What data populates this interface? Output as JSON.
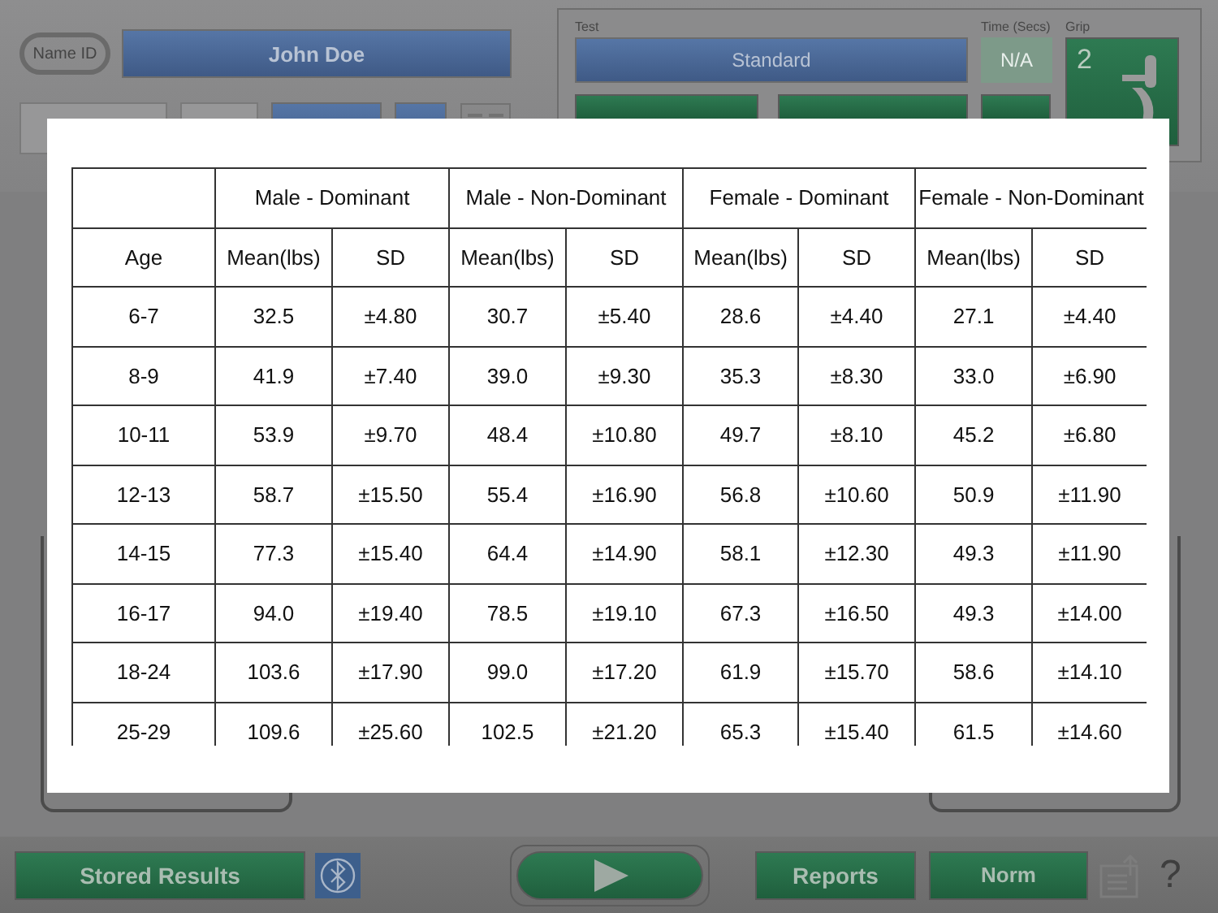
{
  "header": {
    "name_id_label": "Name ID",
    "name": "John Doe"
  },
  "test_panel": {
    "test_label": "Test",
    "test": "Standard",
    "time_label": "Time (Secs)",
    "time": "N/A",
    "grip_label": "Grip",
    "grip": "2"
  },
  "norms_table": {
    "groups": [
      "Male - Dominant",
      "Male - Non-Dominant",
      "Female - Dominant",
      "Female - Non-Dominant"
    ],
    "columns": [
      "Age",
      "Mean(lbs)",
      "SD",
      "Mean(lbs)",
      "SD",
      "Mean(lbs)",
      "SD",
      "Mean(lbs)",
      "SD"
    ],
    "rows": [
      [
        "6-7",
        "32.5",
        "±4.80",
        "30.7",
        "±5.40",
        "28.6",
        "±4.40",
        "27.1",
        "±4.40"
      ],
      [
        "8-9",
        "41.9",
        "±7.40",
        "39.0",
        "±9.30",
        "35.3",
        "±8.30",
        "33.0",
        "±6.90"
      ],
      [
        "10-11",
        "53.9",
        "±9.70",
        "48.4",
        "±10.80",
        "49.7",
        "±8.10",
        "45.2",
        "±6.80"
      ],
      [
        "12-13",
        "58.7",
        "±15.50",
        "55.4",
        "±16.90",
        "56.8",
        "±10.60",
        "50.9",
        "±11.90"
      ],
      [
        "14-15",
        "77.3",
        "±15.40",
        "64.4",
        "±14.90",
        "58.1",
        "±12.30",
        "49.3",
        "±11.90"
      ],
      [
        "16-17",
        "94.0",
        "±19.40",
        "78.5",
        "±19.10",
        "67.3",
        "±16.50",
        "49.3",
        "±14.00"
      ],
      [
        "18-24",
        "103.6",
        "±17.90",
        "99.0",
        "±17.20",
        "61.9",
        "±15.70",
        "58.6",
        "±14.10"
      ],
      [
        "25-29",
        "109.6",
        "±25.60",
        "102.5",
        "±21.20",
        "65.3",
        "±15.40",
        "61.5",
        "±14.60"
      ]
    ]
  },
  "bottom_bar": {
    "stored_results": "Stored Results",
    "reports": "Reports",
    "norm": "Norm",
    "help": "?"
  }
}
